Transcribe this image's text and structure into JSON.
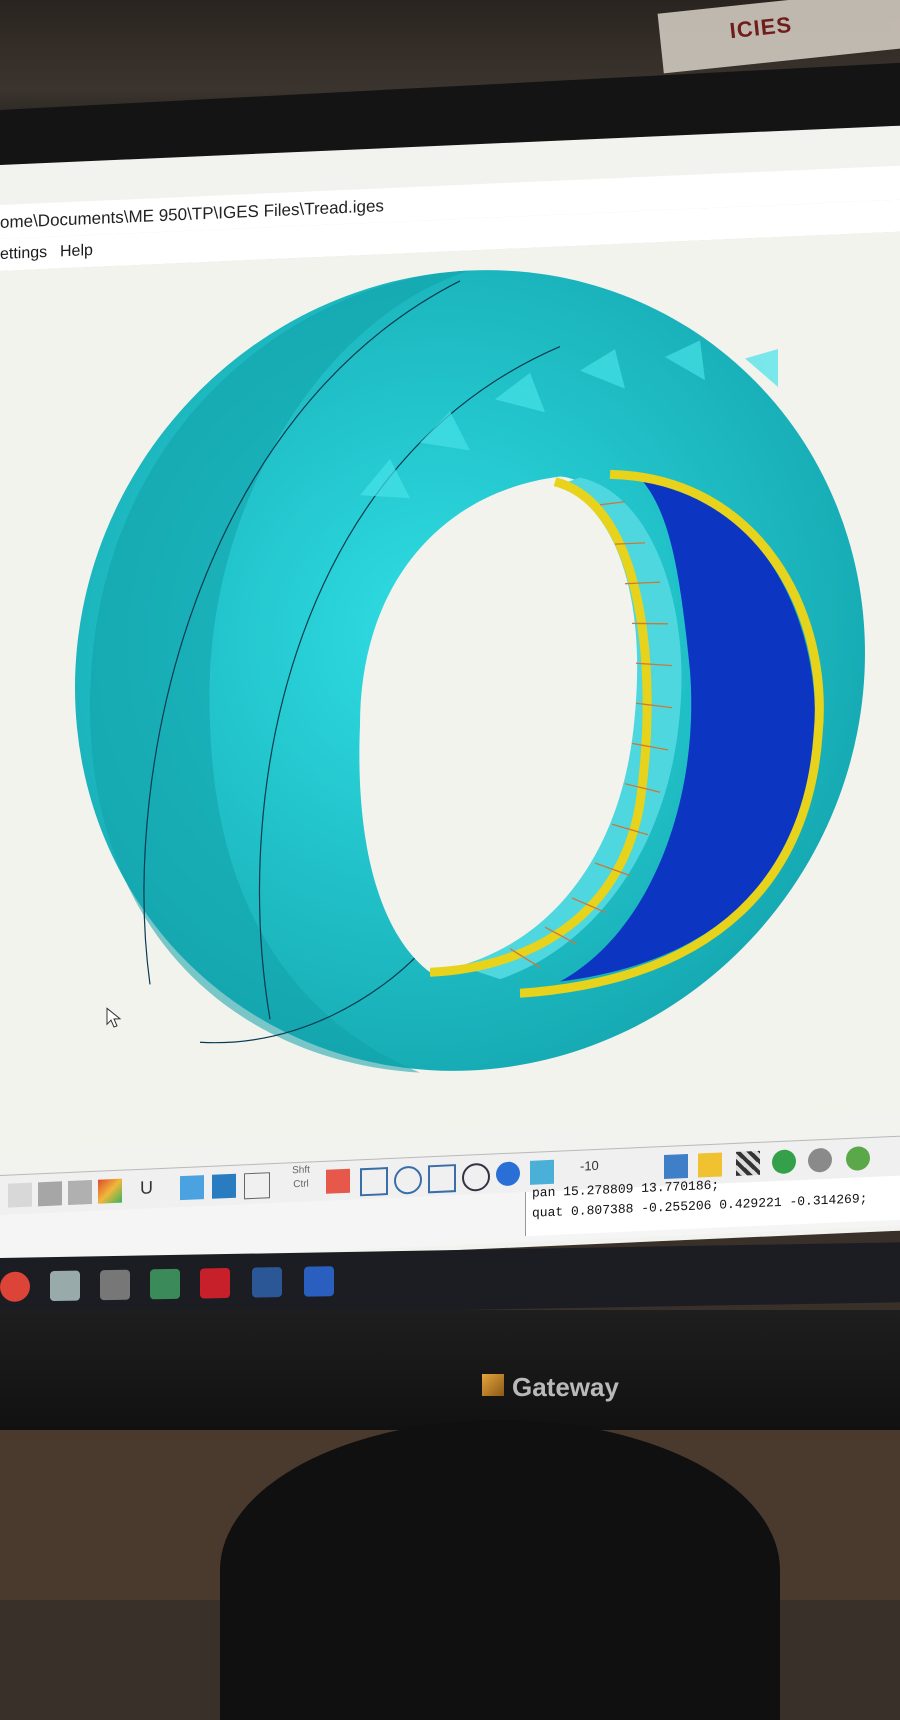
{
  "window": {
    "title": "ome\\Documents\\ME 950\\TP\\IGES Files\\Tread.iges"
  },
  "menu": {
    "items": [
      "ettings",
      "Help"
    ]
  },
  "toolbar": {
    "shift_ctrl_top": "Shft",
    "shift_ctrl_bottom": "Ctrl",
    "u_label": "U",
    "value_label": "-10"
  },
  "status": {
    "line1": "pan 15.278809 13.770186;",
    "line2": "quat 0.807388 -0.255206 0.429221 -0.314269;"
  },
  "poster": {
    "text": "ICIES"
  },
  "monitor": {
    "brand": "Gateway"
  },
  "colors": {
    "tire": "#20c4cc",
    "tire_dark": "#15a3ad",
    "rim": "#e7d21c",
    "inner": "#0c36c2",
    "background": "#f3f3ee"
  }
}
